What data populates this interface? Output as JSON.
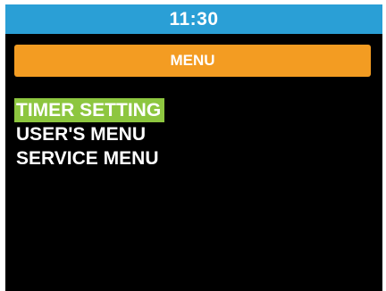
{
  "status_bar": {
    "time": "11:30"
  },
  "header": {
    "title": "MENU"
  },
  "menu": {
    "items": [
      {
        "label": "TIMER SETTING",
        "selected": true
      },
      {
        "label": "USER'S MENU",
        "selected": false
      },
      {
        "label": "SERVICE MENU",
        "selected": false
      }
    ]
  },
  "colors": {
    "status_bar": "#2a9fd6",
    "header": "#f39c22",
    "selection": "#8dc63f",
    "screen_background": "#000000",
    "text": "#ffffff"
  }
}
